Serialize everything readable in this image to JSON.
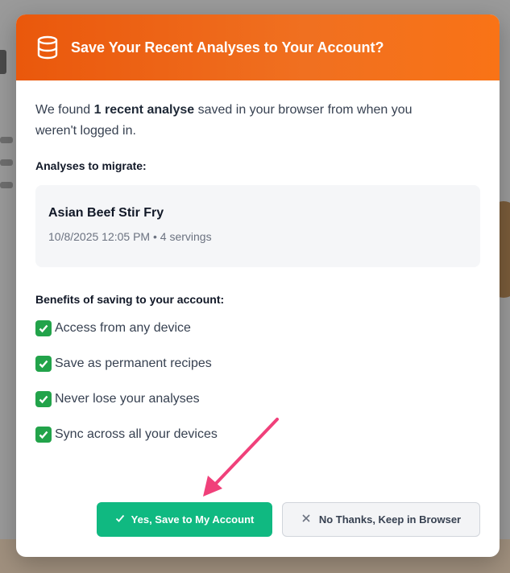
{
  "dialog": {
    "title": "Save Your Recent Analyses to Your Account?",
    "header_icon": "database-icon",
    "accent_color": "#f97316",
    "intro_prefix": "We found ",
    "intro_bold": "1 recent analyse",
    "intro_suffix": " saved in your browser from when you weren't logged in.",
    "analyses_label": "Analyses to migrate:",
    "analyses": [
      {
        "name": "Asian Beef Stir Fry",
        "meta": "10/8/2025 12:05 PM • 4 servings"
      }
    ],
    "benefits_label": "Benefits of saving to your account:",
    "benefits": [
      "Access from any device",
      "Save as permanent recipes",
      "Never lose your analyses",
      "Sync across all your devices"
    ],
    "primary_button": "Yes, Save to My Account",
    "primary_color": "#10b981",
    "secondary_button": "No Thanks, Keep in Browser"
  }
}
